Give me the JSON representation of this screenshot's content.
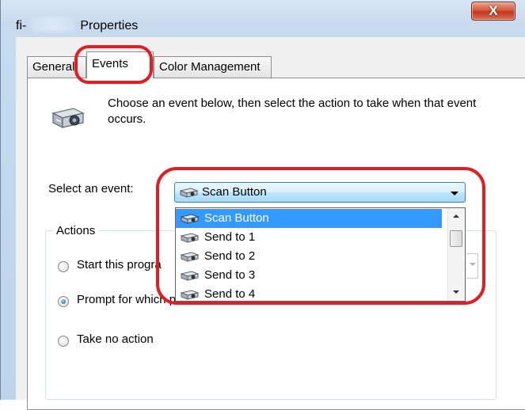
{
  "window": {
    "title_prefix": "fi-",
    "title_suffix": "Properties",
    "close_label": "X",
    "title_icon": "redacted-model-name"
  },
  "tabs": [
    {
      "label": "General"
    },
    {
      "label": "Events",
      "active": true
    },
    {
      "label": "Color Management"
    }
  ],
  "events_panel": {
    "icon": "scanner-icon",
    "description": "Choose an event below, then select the action to take when that event occurs.",
    "select_label": "Select an event:",
    "selected_event": "Scan Button",
    "dropdown_options": [
      "Scan Button",
      "Send to 1",
      "Send to 2",
      "Send to 3",
      "Send to 4"
    ],
    "highlighted_option": "Scan Button"
  },
  "actions": {
    "group_label": "Actions",
    "start_program_label": "Start this progra",
    "prompt_label": "Prompt for which pro",
    "no_action_label": "Take no action",
    "selected": "Prompt for which program"
  },
  "colors": {
    "highlight": "#3399ff",
    "annotation_ring": "#e51c23",
    "combo_border": "#3c7fb1"
  }
}
